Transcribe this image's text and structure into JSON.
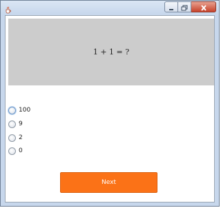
{
  "window": {
    "icon": "java-cup-icon",
    "buttons": [
      "minimize-icon",
      "maximize-icon",
      "close-icon"
    ]
  },
  "question": {
    "text": "1 + 1 = ?"
  },
  "options": [
    {
      "label": "100"
    },
    {
      "label": "9"
    },
    {
      "label": "2"
    },
    {
      "label": "0"
    }
  ],
  "next_button": {
    "label": "Next",
    "color": "#fb7217"
  },
  "colors": {
    "question_panel": "#cccccc",
    "client_background": "#ffffff"
  }
}
